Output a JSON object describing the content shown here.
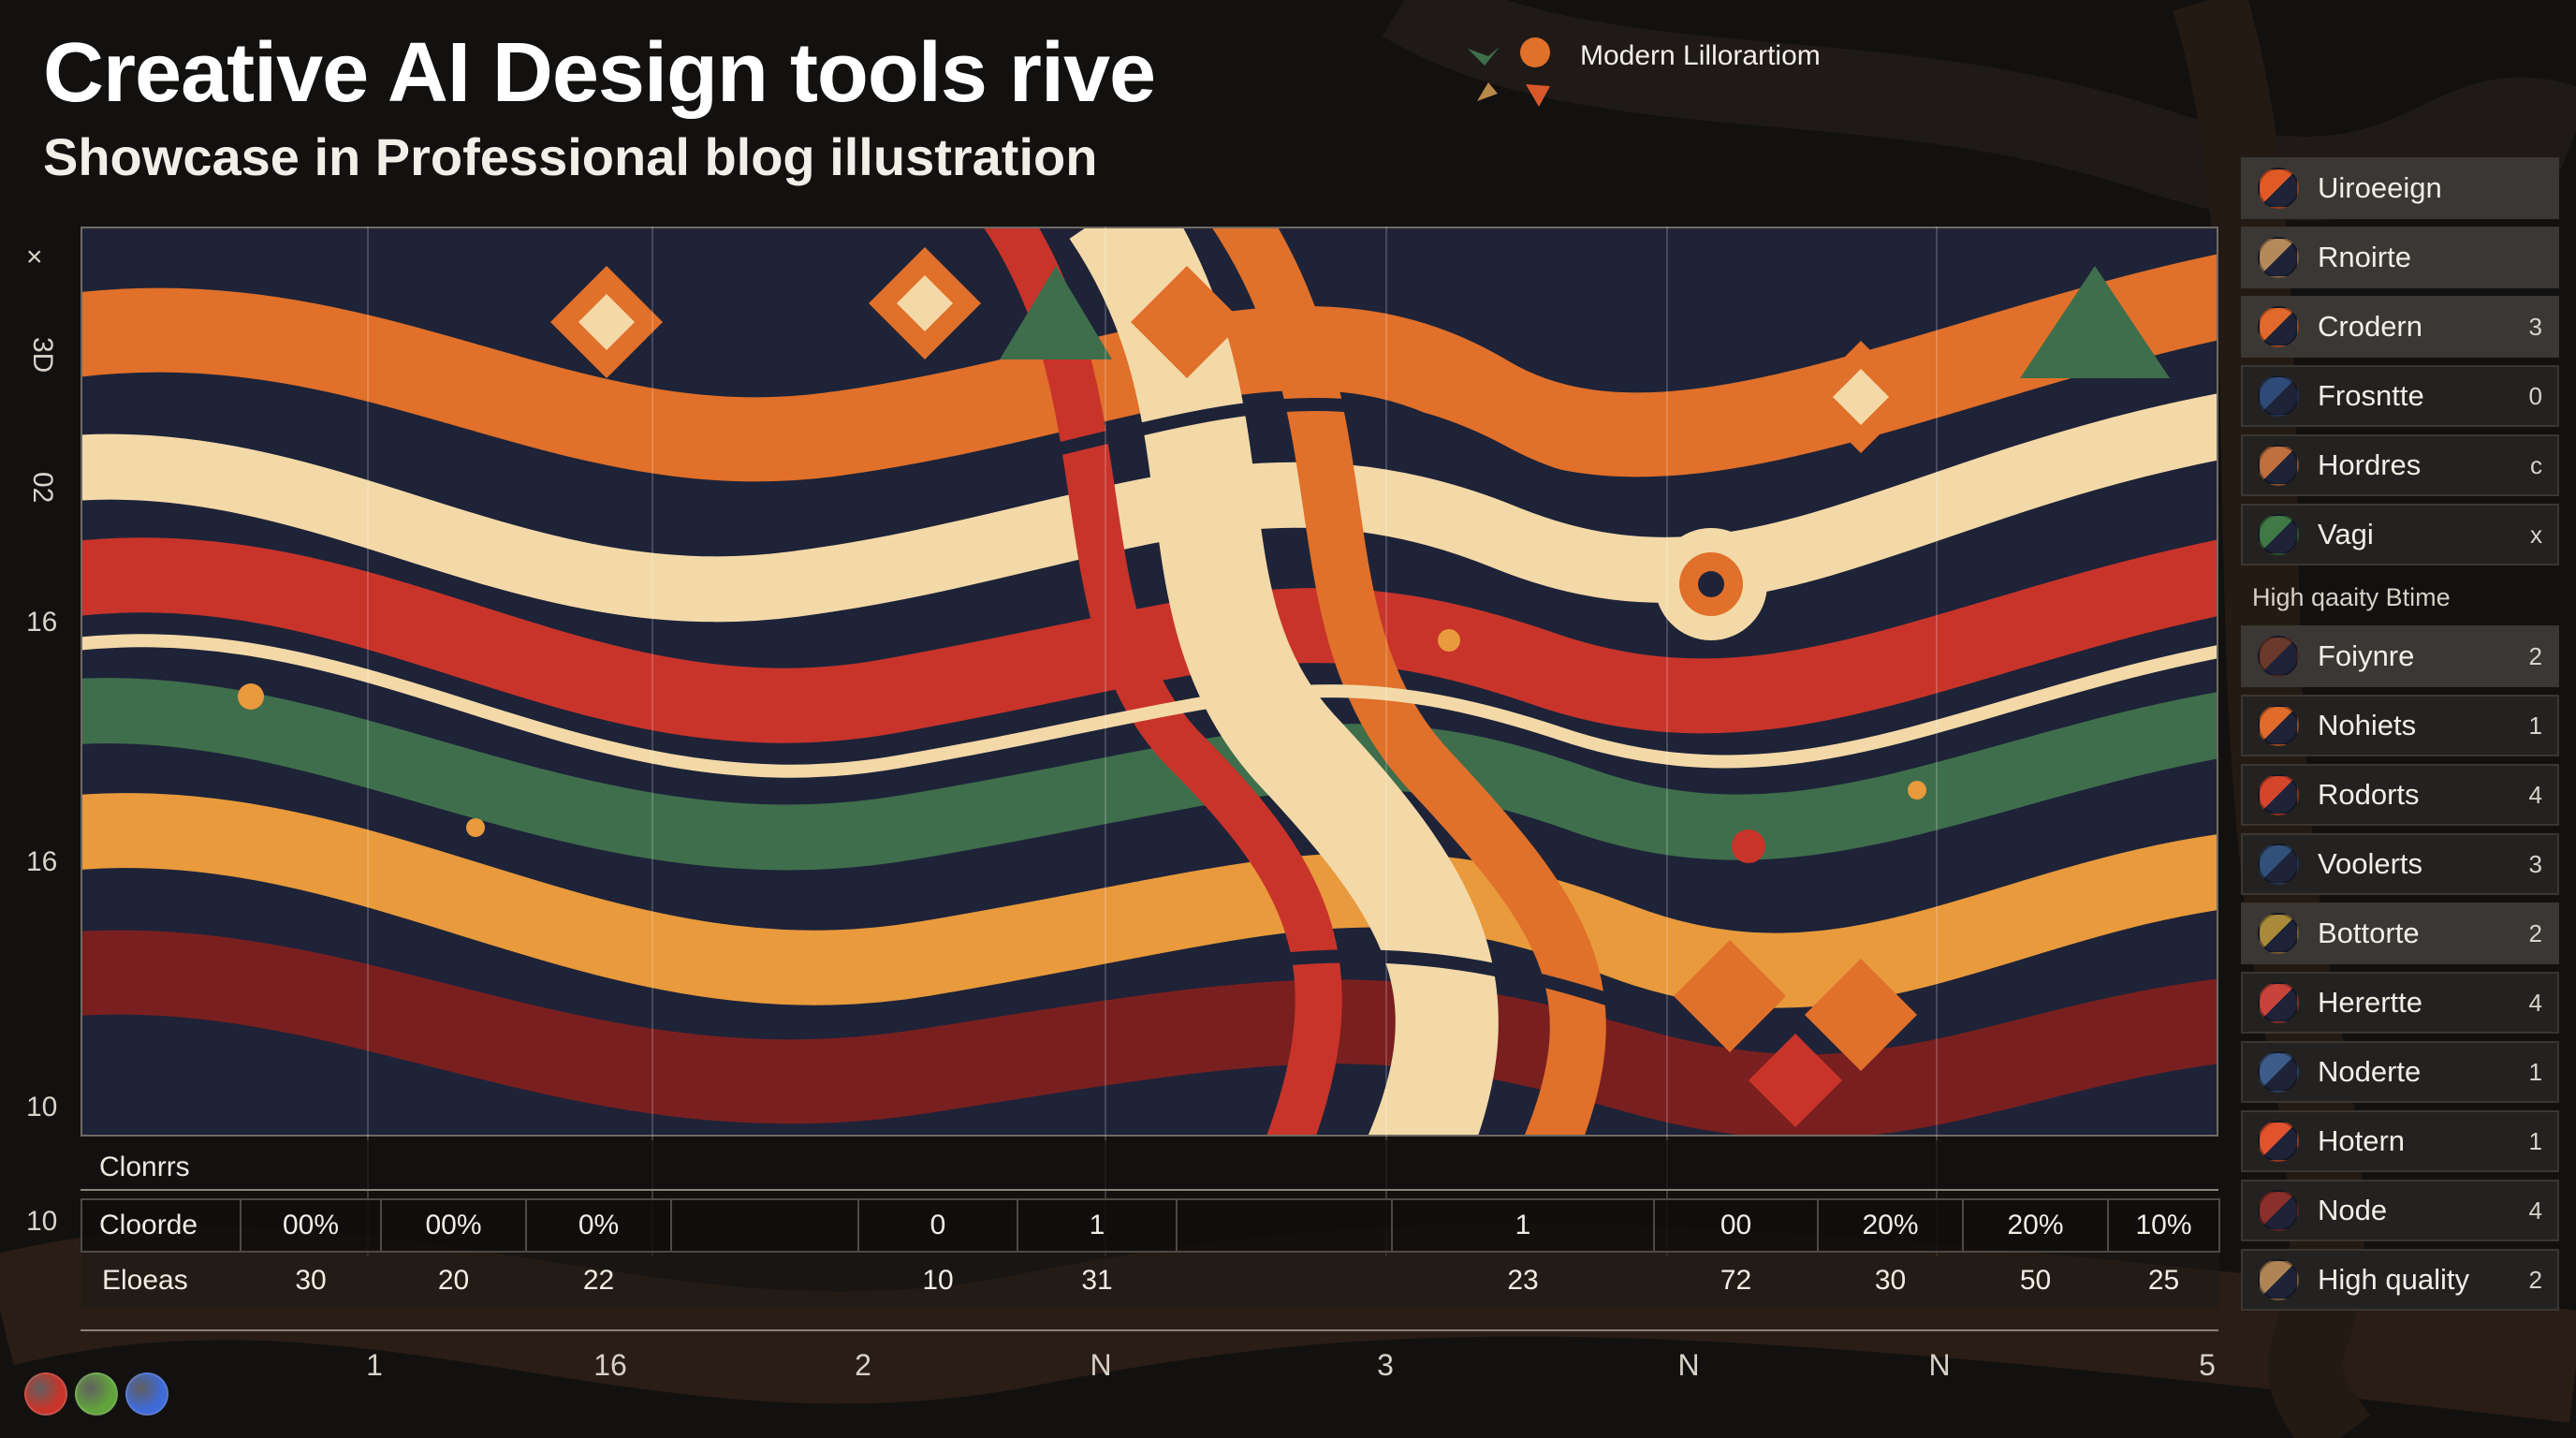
{
  "header": {
    "title": "Creative AI Design tools rive",
    "subtitle": "Showcase in Professional blog illustration",
    "legend_label": "Modern Lillorartiom"
  },
  "y_axis": {
    "close_glyph": "×",
    "ticks": [
      "3D",
      "02",
      "16",
      "16",
      "10",
      "10"
    ]
  },
  "strip": {
    "header_label": "Clonrrs",
    "row1_label": "Cloorde",
    "row1_values": [
      "00%",
      "00%",
      "0%",
      "",
      "0",
      "1",
      "",
      "1",
      "00",
      "20%",
      "20%",
      "10%"
    ],
    "row2_label": "Eloeas",
    "row2_values": [
      "30",
      "20",
      "22",
      "",
      "10",
      "31",
      "",
      "23",
      "72",
      "30",
      "50",
      "25"
    ]
  },
  "x_axis": {
    "ticks": [
      "1",
      "16",
      "2",
      "N",
      "3",
      "N",
      "N",
      "5"
    ]
  },
  "swatches": {
    "colors": [
      "#c8342a",
      "#62a33c",
      "#3f6ad8"
    ]
  },
  "sidebar": {
    "top_items": [
      {
        "label": "Uiroeeign",
        "count": "",
        "color": "#e05a26",
        "icon": "orange-swatch-icon"
      },
      {
        "label": "Rnoirte",
        "count": "",
        "color": "#b58a5a",
        "icon": "tan-swatch-icon"
      },
      {
        "label": "Crodern",
        "count": "3",
        "color": "#e2692c",
        "icon": "orange-swatch-icon"
      },
      {
        "label": "Frosntte",
        "count": "0",
        "color": "#2e4a78",
        "icon": "blue-swatch-icon"
      },
      {
        "label": "Hordres",
        "count": "c",
        "color": "#c0703e",
        "icon": "rust-swatch-icon"
      },
      {
        "label": "Vagi",
        "count": "x",
        "color": "#3f7a46",
        "icon": "green-swatch-icon"
      }
    ],
    "group_label": "High qaaity Btime",
    "bottom_items": [
      {
        "label": "Foiynre",
        "count": "2",
        "color": "#6b3a2c",
        "icon": "brown-swatch-icon"
      },
      {
        "label": "Nohiets",
        "count": "1",
        "color": "#e06b2a",
        "icon": "orange-swatch-icon"
      },
      {
        "label": "Rodorts",
        "count": "4",
        "color": "#d4452c",
        "icon": "red-swatch-icon"
      },
      {
        "label": "Voolerts",
        "count": "3",
        "color": "#31507a",
        "icon": "blue-swatch-icon"
      },
      {
        "label": "Bottorte",
        "count": "2",
        "color": "#a88a3a",
        "icon": "gold-swatch-icon"
      },
      {
        "label": "Herertte",
        "count": "4",
        "color": "#c8433a",
        "icon": "multicolor-swatch-icon"
      },
      {
        "label": "Noderte",
        "count": "1",
        "color": "#3d5c8a",
        "icon": "multicolor-swatch-icon"
      },
      {
        "label": "Hotern",
        "count": "1",
        "color": "#e2522c",
        "icon": "red-swatch-icon"
      },
      {
        "label": "Node",
        "count": "4",
        "color": "#8a2f2a",
        "icon": "maroon-swatch-icon"
      },
      {
        "label": "High quality",
        "count": "2",
        "color": "#b08555",
        "icon": "tan-swatch-icon"
      }
    ]
  },
  "palette": {
    "orange": "#e0702a",
    "cream": "#f3d9a8",
    "navy": "#1f2a44",
    "maroon": "#7a1f1f",
    "green": "#3f6e4c",
    "red": "#c8342a",
    "dark": "#121110"
  }
}
